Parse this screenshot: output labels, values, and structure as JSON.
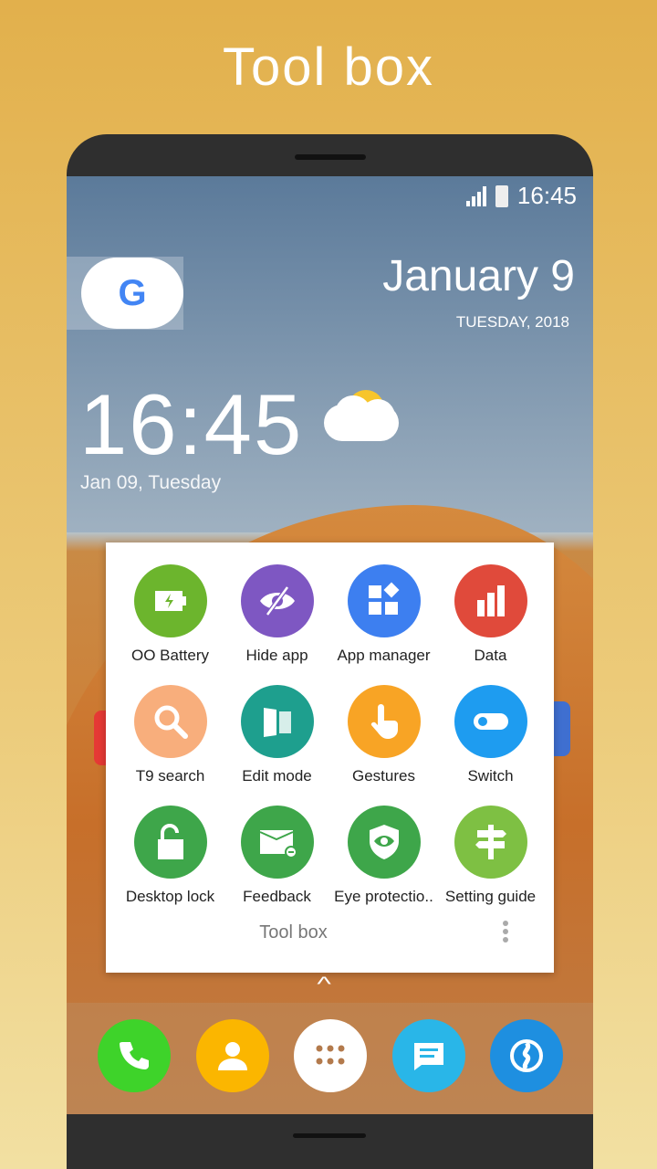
{
  "headline": "Tool box",
  "status": {
    "time": "16:45"
  },
  "widget": {
    "month_day": "January 9",
    "weekday_year": "TUESDAY, 2018",
    "clock": "16:45",
    "date_line": "Jan 09, Tuesday",
    "google_letter": "G"
  },
  "toolbox": {
    "title": "Tool box",
    "items": [
      {
        "label": "OO Battery",
        "icon": "battery-charging-icon",
        "color": "#6cb52d"
      },
      {
        "label": "Hide app",
        "icon": "eye-off-icon",
        "color": "#7e57c2"
      },
      {
        "label": "App manager",
        "icon": "apps-grid-icon",
        "color": "#3d7ff0"
      },
      {
        "label": "Data",
        "icon": "bar-chart-icon",
        "color": "#e04a3b"
      },
      {
        "label": "T9 search",
        "icon": "magnifier-icon",
        "color": "#f8ae7c"
      },
      {
        "label": "Edit mode",
        "icon": "panels-icon",
        "color": "#1e9f8e"
      },
      {
        "label": "Gestures",
        "icon": "hand-pointer-icon",
        "color": "#f8a425"
      },
      {
        "label": "Switch",
        "icon": "toggle-icon",
        "color": "#1e9cf0"
      },
      {
        "label": "Desktop lock",
        "icon": "unlock-icon",
        "color": "#3ea64a"
      },
      {
        "label": "Feedback",
        "icon": "envelope-icon",
        "color": "#3ea64a"
      },
      {
        "label": "Eye protectio..",
        "icon": "shield-eye-icon",
        "color": "#3ea64a"
      },
      {
        "label": "Setting guide",
        "icon": "signpost-icon",
        "color": "#7ec043"
      }
    ]
  },
  "dock": [
    {
      "name": "phone",
      "icon": "phone-icon",
      "color": "#3ed32a"
    },
    {
      "name": "contacts",
      "icon": "person-icon",
      "color": "#fbb600"
    },
    {
      "name": "app-drawer",
      "icon": "app-drawer-icon",
      "color": "#ffffff"
    },
    {
      "name": "messages",
      "icon": "message-icon",
      "color": "#29b6e8"
    },
    {
      "name": "browser",
      "icon": "browser-icon",
      "color": "#1e8fe0"
    }
  ]
}
